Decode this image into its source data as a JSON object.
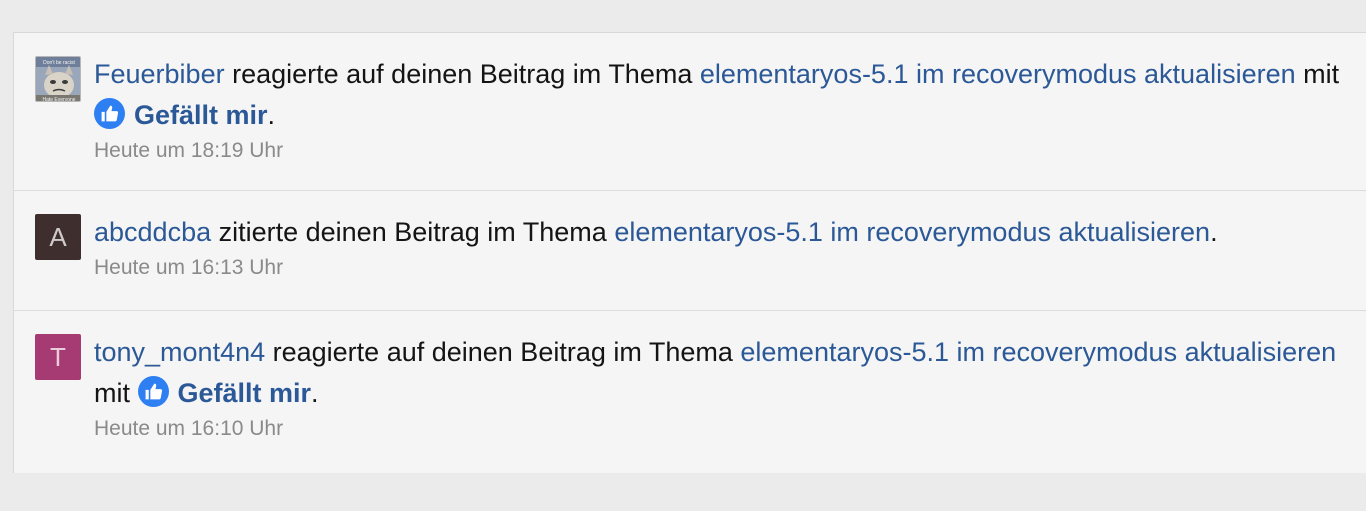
{
  "notifications": [
    {
      "user": "Feuerbiber",
      "avatar": {
        "type": "image",
        "caption": "Don't be racist Hate Everyone"
      },
      "action": " reagierte auf deinen Beitrag im Thema ",
      "thread": "elementaryos-5.1 im recoverymodus aktualisieren",
      "connector": " mit ",
      "reaction": "Gefällt mir",
      "end": ".",
      "time": "Heute um 18:19 Uhr"
    },
    {
      "user": "abcddcba",
      "avatar": {
        "type": "letter",
        "letter": "A",
        "color": "#3f2e2e"
      },
      "action": " zitierte deinen Beitrag im Thema ",
      "thread": "elementaryos-5.1 im recoverymodus aktualisieren",
      "end": ".",
      "time": "Heute um 16:13 Uhr"
    },
    {
      "user": "tony_mont4n4",
      "avatar": {
        "type": "letter",
        "letter": "T",
        "color": "#a63a73"
      },
      "action": " reagierte auf deinen Beitrag im Thema ",
      "thread": "elementaryos-5.1 im recoverymodus aktualisieren",
      "connector": " mit ",
      "reaction": "Gefällt mir",
      "end": ".",
      "time": "Heute um 16:10 Uhr"
    }
  ],
  "icons": {
    "reaction": "thumbs-up-icon"
  },
  "colors": {
    "link": "#2b5896",
    "like": "#2d7ff2",
    "time": "#8a8a8a"
  }
}
